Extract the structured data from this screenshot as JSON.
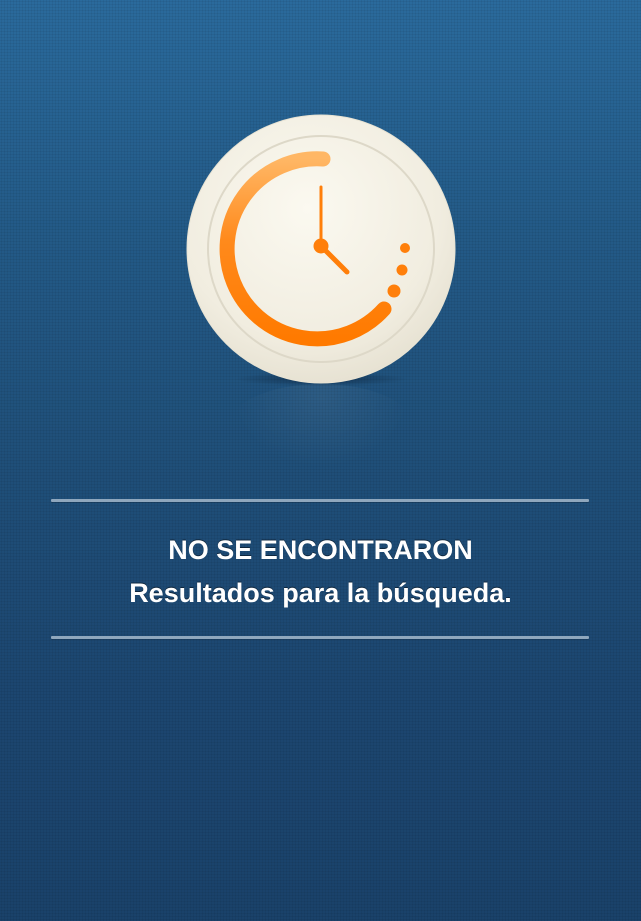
{
  "empty_state": {
    "icon": "clock-icon",
    "title": "NO SE ENCONTRARON",
    "subtitle": "Resultados para la búsqueda."
  },
  "colors": {
    "background_top": "#2a6a9c",
    "background_bottom": "#1a426a",
    "clock_face": "#f5f2e6",
    "accent_orange": "#ff8210",
    "divider": "#8fa7bd",
    "text": "#ffffff"
  }
}
